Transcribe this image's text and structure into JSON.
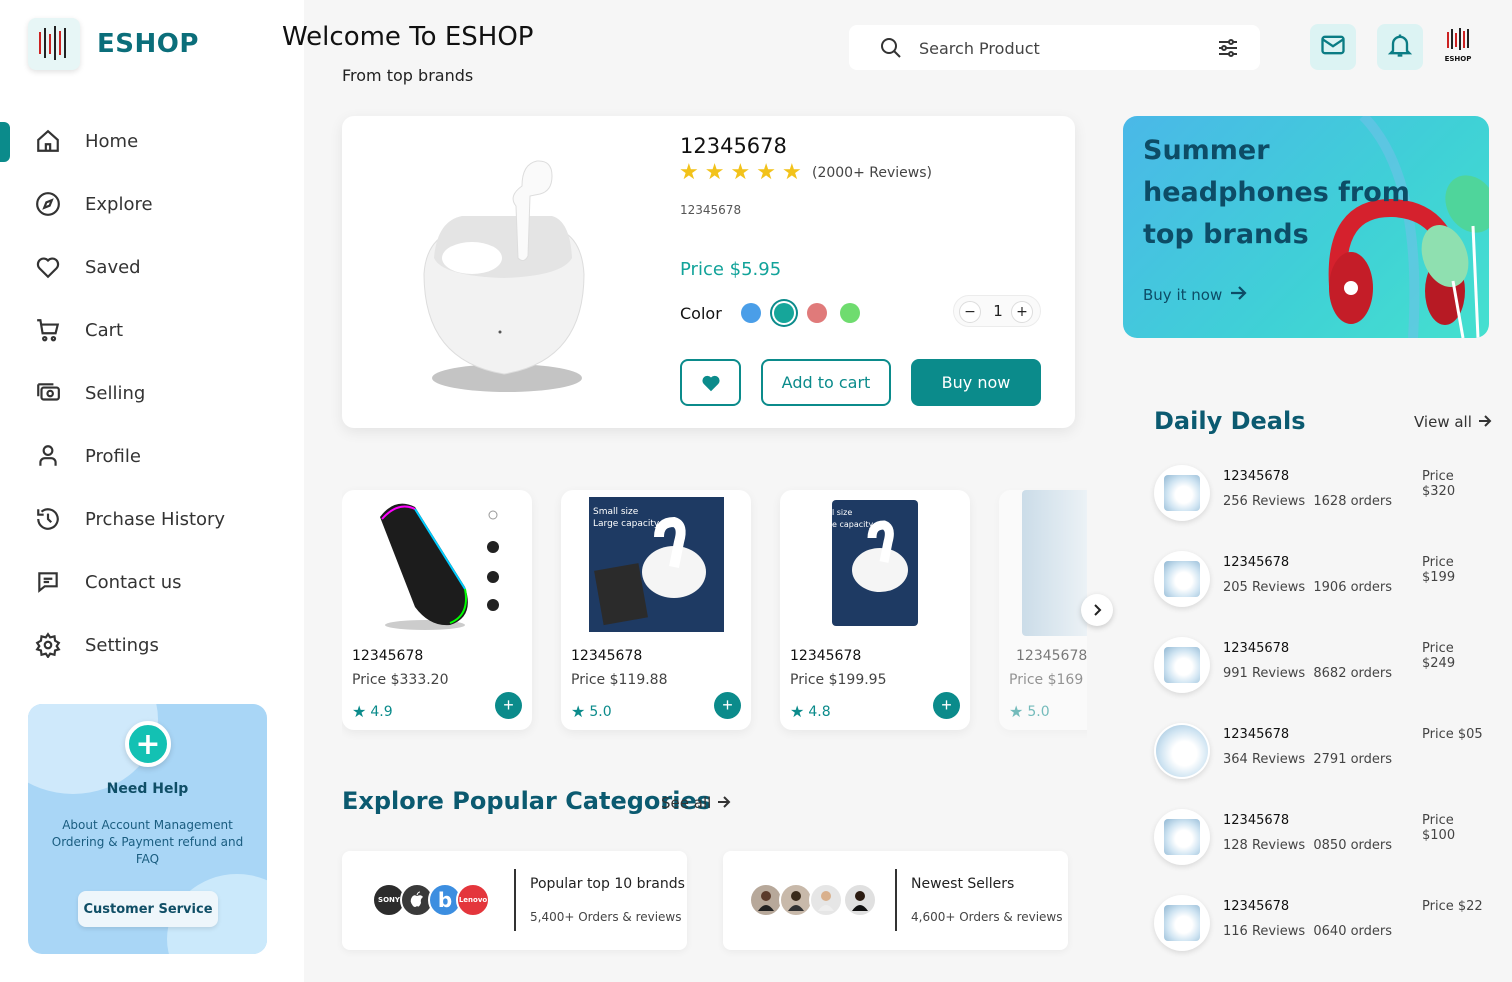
{
  "brand": {
    "name": "ESHOP",
    "mini_logo_text": "ESHOP"
  },
  "header": {
    "welcome": "Welcome To ESHOP",
    "subtitle": "From top brands",
    "search_placeholder": "Search Product"
  },
  "sidebar": {
    "items": [
      {
        "label": "Home",
        "icon": "home-icon",
        "active": true
      },
      {
        "label": "Explore",
        "icon": "compass-icon"
      },
      {
        "label": "Saved",
        "icon": "heart-icon"
      },
      {
        "label": "Cart",
        "icon": "cart-icon"
      },
      {
        "label": "Selling",
        "icon": "money-icon"
      },
      {
        "label": "Profile",
        "icon": "user-icon"
      },
      {
        "label": "Prchase History",
        "icon": "history-icon"
      },
      {
        "label": "Contact us",
        "icon": "chat-icon"
      },
      {
        "label": "Settings",
        "icon": "gear-icon"
      }
    ],
    "help": {
      "title": "Need Help",
      "description": "About Account Management Ordering & Payment refund and FAQ",
      "button": "Customer Service"
    }
  },
  "featured": {
    "name": "12345678",
    "rating_stars": 5,
    "reviews": "(2000+ Reviews)",
    "sku": "12345678",
    "price": "Price $5.95",
    "color_label": "Color",
    "colors": [
      "#4a9ee8",
      "#16a69a",
      "#e07a7a",
      "#6fdc6f"
    ],
    "selected_color_index": 1,
    "quantity": "1",
    "add_to_cart": "Add to cart",
    "buy_now": "Buy now"
  },
  "promo": {
    "title": "Summer headphones from top brands",
    "link": "Buy it now"
  },
  "products": [
    {
      "name": "12345678",
      "price": "Price $333.20",
      "rating": "4.9"
    },
    {
      "name": "12345678",
      "price": "Price $119.88",
      "rating": "5.0"
    },
    {
      "name": "12345678",
      "price": "Price $199.95",
      "rating": "4.8"
    },
    {
      "name": "12345678",
      "price": "Price $169",
      "rating": "5.0"
    }
  ],
  "categories": {
    "title": "Explore Popular Categories",
    "see_all": "See all",
    "cards": [
      {
        "title": "Popular top 10 brands",
        "subtitle": "5,400+ Orders & reviews",
        "brands": [
          "SONY",
          "",
          "b",
          "Lenovo"
        ]
      },
      {
        "title": "Newest Sellers",
        "subtitle": "4,600+ Orders & reviews"
      }
    ]
  },
  "deals": {
    "title": "Daily Deals",
    "view_all": "View all",
    "items": [
      {
        "name": "12345678",
        "reviews": "256 Reviews",
        "orders": "1628 orders",
        "price": "Price $320"
      },
      {
        "name": "12345678",
        "reviews": "205 Reviews",
        "orders": "1906 orders",
        "price": "Price $199"
      },
      {
        "name": "12345678",
        "reviews": "991 Reviews",
        "orders": "8682 orders",
        "price": "Price $249"
      },
      {
        "name": "12345678",
        "reviews": "364 Reviews",
        "orders": "2791 orders",
        "price": "Price $05"
      },
      {
        "name": "12345678",
        "reviews": "128 Reviews",
        "orders": "0850 orders",
        "price": "Price $100"
      },
      {
        "name": "12345678",
        "reviews": "116 Reviews",
        "orders": "0640 orders",
        "price": "Price $22"
      }
    ]
  }
}
